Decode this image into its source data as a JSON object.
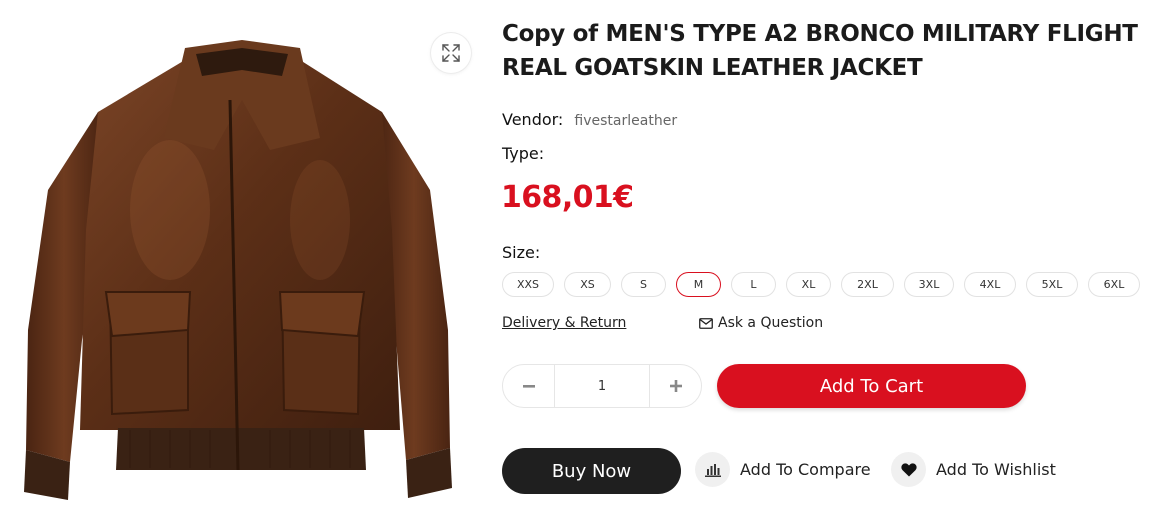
{
  "product": {
    "title": "Copy of MEN'S TYPE A2 BRONCO MILITARY FLIGHT REAL GOATSKIN LEATHER JACKET",
    "vendor_label": "Vendor:",
    "vendor_value": "fivestarleather",
    "type_label": "Type:",
    "price": "168,01€",
    "image_icon": "jacket-image",
    "zoom_icon": "expand-icon"
  },
  "size": {
    "label": "Size:",
    "selected": "M",
    "options": [
      "XXS",
      "XS",
      "S",
      "M",
      "L",
      "XL",
      "2XL",
      "3XL",
      "4XL",
      "5XL",
      "6XL"
    ]
  },
  "links": {
    "delivery": "Delivery & Return",
    "ask": "Ask a Question",
    "ask_icon": "envelope-icon"
  },
  "quantity": {
    "value": "1",
    "minus_icon": "minus-icon",
    "plus_icon": "plus-icon"
  },
  "buttons": {
    "add_to_cart": "Add To Cart",
    "buy_now": "Buy Now",
    "compare": "Add To Compare",
    "compare_icon": "bar-chart-icon",
    "wishlist": "Add To Wishlist",
    "wishlist_icon": "heart-icon"
  },
  "colors": {
    "accent": "#d9101f",
    "dark_button": "#1f1f1f",
    "leather": "#6b3a1f"
  }
}
